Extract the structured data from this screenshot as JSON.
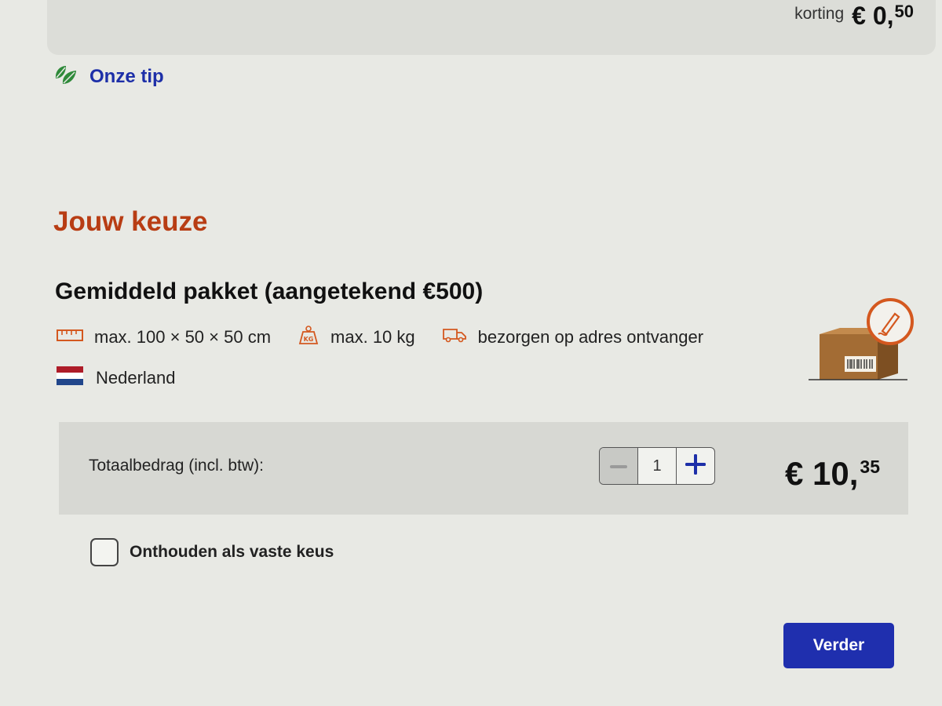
{
  "discount": {
    "label": "korting",
    "currency": "€",
    "whole": "0,",
    "cents": "50"
  },
  "tip": {
    "icon": "leaf-icon",
    "label": "Onze tip",
    "color": "#1d2fa8"
  },
  "choice": {
    "heading": "Jouw keuze",
    "product_title": "Gemiddeld pakket (aangetekend €500)",
    "specs": [
      {
        "icon": "ruler-icon",
        "text": "max. 100 × 50 × 50 cm"
      },
      {
        "icon": "weight-icon",
        "text": "max. 10 kg"
      },
      {
        "icon": "delivery-van-icon",
        "text": "bezorgen op adres ontvanger"
      }
    ],
    "country": {
      "icon": "dutch-flag-icon",
      "name": "Nederland"
    }
  },
  "total": {
    "label": "Totaalbedrag (incl. btw):",
    "quantity": "1",
    "currency": "€",
    "whole": "10,",
    "cents": "35"
  },
  "remember": {
    "label": "Onthouden als vaste keus",
    "checked": false
  },
  "next_button": {
    "label": "Verder"
  },
  "colors": {
    "accent": "#b83d14",
    "primary": "#1f2fae",
    "icon_orange": "#d4581f",
    "leaf_green": "#2f8a3a"
  }
}
